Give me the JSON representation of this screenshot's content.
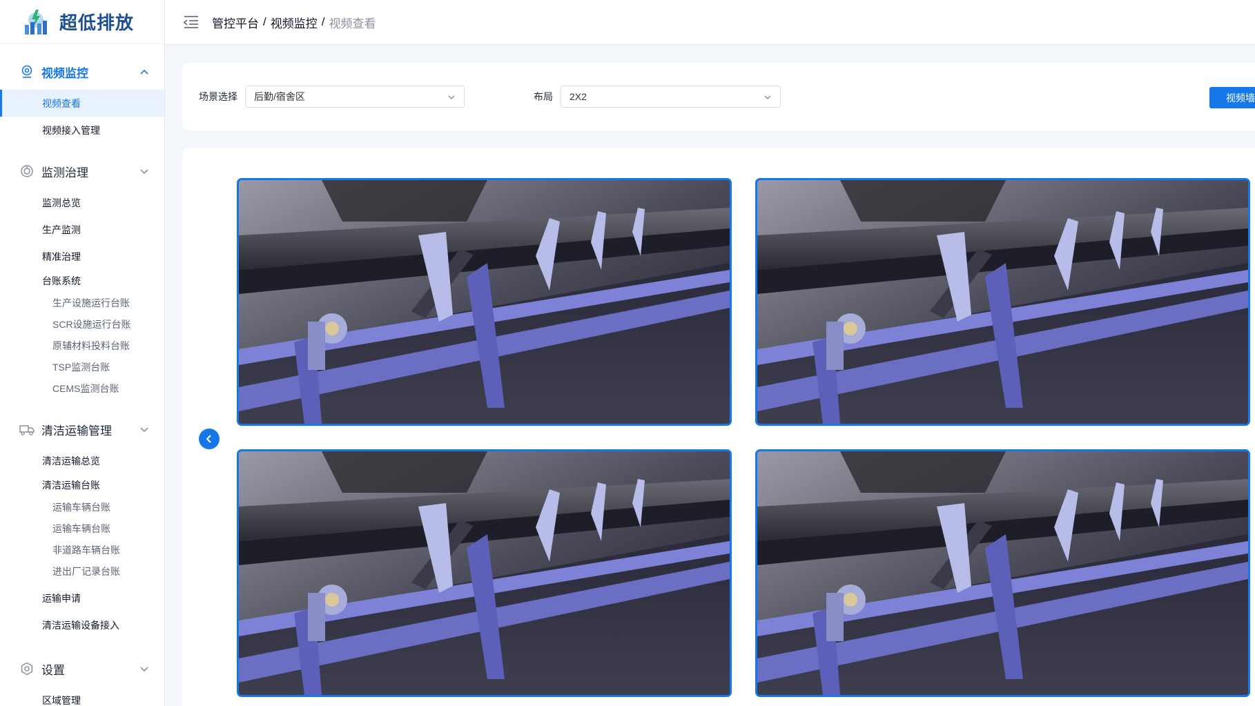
{
  "app": {
    "title": "超低排放"
  },
  "header": {
    "breadcrumb": [
      "管控平台",
      "视频监控",
      "视频查看"
    ],
    "separator": "/"
  },
  "sidebar": {
    "groups": [
      {
        "label": "视频监控",
        "icon": "camera-pin-icon",
        "expanded": true,
        "items": [
          {
            "label": "视频查看",
            "active": true
          },
          {
            "label": "视频接入管理"
          }
        ]
      },
      {
        "label": "监测治理",
        "icon": "gauge-icon",
        "expanded": false,
        "items": [
          {
            "label": "监测总览"
          },
          {
            "label": "生产监测"
          },
          {
            "label": "精准治理"
          },
          {
            "label": "台账系统"
          }
        ],
        "subitems": [
          "生产设施运行台账",
          "SCR设施运行台账",
          "原辅材料投料台账",
          "TSP监测台账",
          "CEMS监测台账"
        ]
      },
      {
        "label": "清洁运输管理",
        "icon": "truck-icon",
        "expanded": false,
        "items_top": [
          {
            "label": "清洁运输总览"
          },
          {
            "label": "清洁运输台账"
          }
        ],
        "subitems": [
          "运输车辆台账",
          "运输车辆台账",
          "非道路车辆台账",
          "进出厂记录台账"
        ],
        "items_bottom": [
          {
            "label": "运输申请"
          },
          {
            "label": "清洁运输设备接入"
          }
        ]
      },
      {
        "label": "设置",
        "icon": "settings-icon",
        "expanded": false,
        "items": [
          {
            "label": "区域管理"
          }
        ]
      }
    ]
  },
  "filter": {
    "scene_label": "场景选择",
    "scene_value": "后勤/宿舍区",
    "layout_label": "布局",
    "layout_value": "2X2",
    "wall_button": "视频墙"
  },
  "colors": {
    "accent": "#1677e8",
    "brand": "#1d4f91"
  }
}
